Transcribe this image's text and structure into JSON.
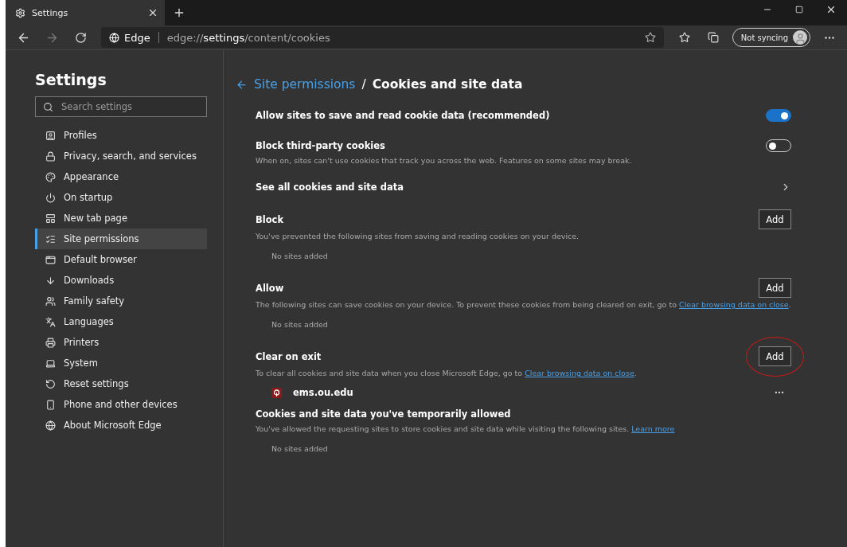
{
  "browser": {
    "tab_title": "Settings",
    "address_brand": "Edge",
    "address_scheme": "edge://",
    "address_host": "settings",
    "address_path": "/content/cookies",
    "sync_label": "Not syncing"
  },
  "sidebar": {
    "title": "Settings",
    "search_placeholder": "Search settings",
    "items": [
      {
        "label": "Profiles",
        "selected": false
      },
      {
        "label": "Privacy, search, and services",
        "selected": false
      },
      {
        "label": "Appearance",
        "selected": false
      },
      {
        "label": "On startup",
        "selected": false
      },
      {
        "label": "New tab page",
        "selected": false
      },
      {
        "label": "Site permissions",
        "selected": true
      },
      {
        "label": "Default browser",
        "selected": false
      },
      {
        "label": "Downloads",
        "selected": false
      },
      {
        "label": "Family safety",
        "selected": false
      },
      {
        "label": "Languages",
        "selected": false
      },
      {
        "label": "Printers",
        "selected": false
      },
      {
        "label": "System",
        "selected": false
      },
      {
        "label": "Reset settings",
        "selected": false
      },
      {
        "label": "Phone and other devices",
        "selected": false
      },
      {
        "label": "About Microsoft Edge",
        "selected": false
      }
    ]
  },
  "page": {
    "breadcrumb_parent": "Site permissions",
    "breadcrumb_separator": "/",
    "title": "Cookies and site data",
    "sections": [
      {
        "kind": "toggle",
        "title": "Allow sites to save and read cookie data (recommended)",
        "on": true
      },
      {
        "kind": "toggle",
        "title": "Block third-party cookies",
        "description": "When on, sites can't use cookies that track you across the web. Features on some sites may break.",
        "on": false
      },
      {
        "kind": "link",
        "title": "See all cookies and site data"
      },
      {
        "kind": "list",
        "title": "Block",
        "description": "You've prevented the following sites from saving and reading cookies on your device.",
        "button": "Add",
        "empty_text": "No sites added"
      },
      {
        "kind": "list",
        "title": "Allow",
        "description": "The following sites can save cookies on your device. To prevent these cookies from being cleared on exit, go to ",
        "link": "Clear browsing data on close",
        "description_end": ".",
        "button": "Add",
        "empty_text": "No sites added"
      },
      {
        "kind": "list",
        "title": "Clear on exit",
        "description": "To clear all cookies and site data when you close Microsoft Edge, go to ",
        "link": "Clear browsing data on close",
        "description_end": ".",
        "button": "Add",
        "highlighted": true,
        "sites": [
          {
            "domain": "ems.ou.edu"
          }
        ]
      },
      {
        "kind": "list",
        "title": "Cookies and site data you've temporarily allowed",
        "description": "You've allowed the requesting sites to store cookies and site data while visiting the following sites. ",
        "link": "Learn more",
        "empty_text": "No sites added"
      }
    ]
  }
}
